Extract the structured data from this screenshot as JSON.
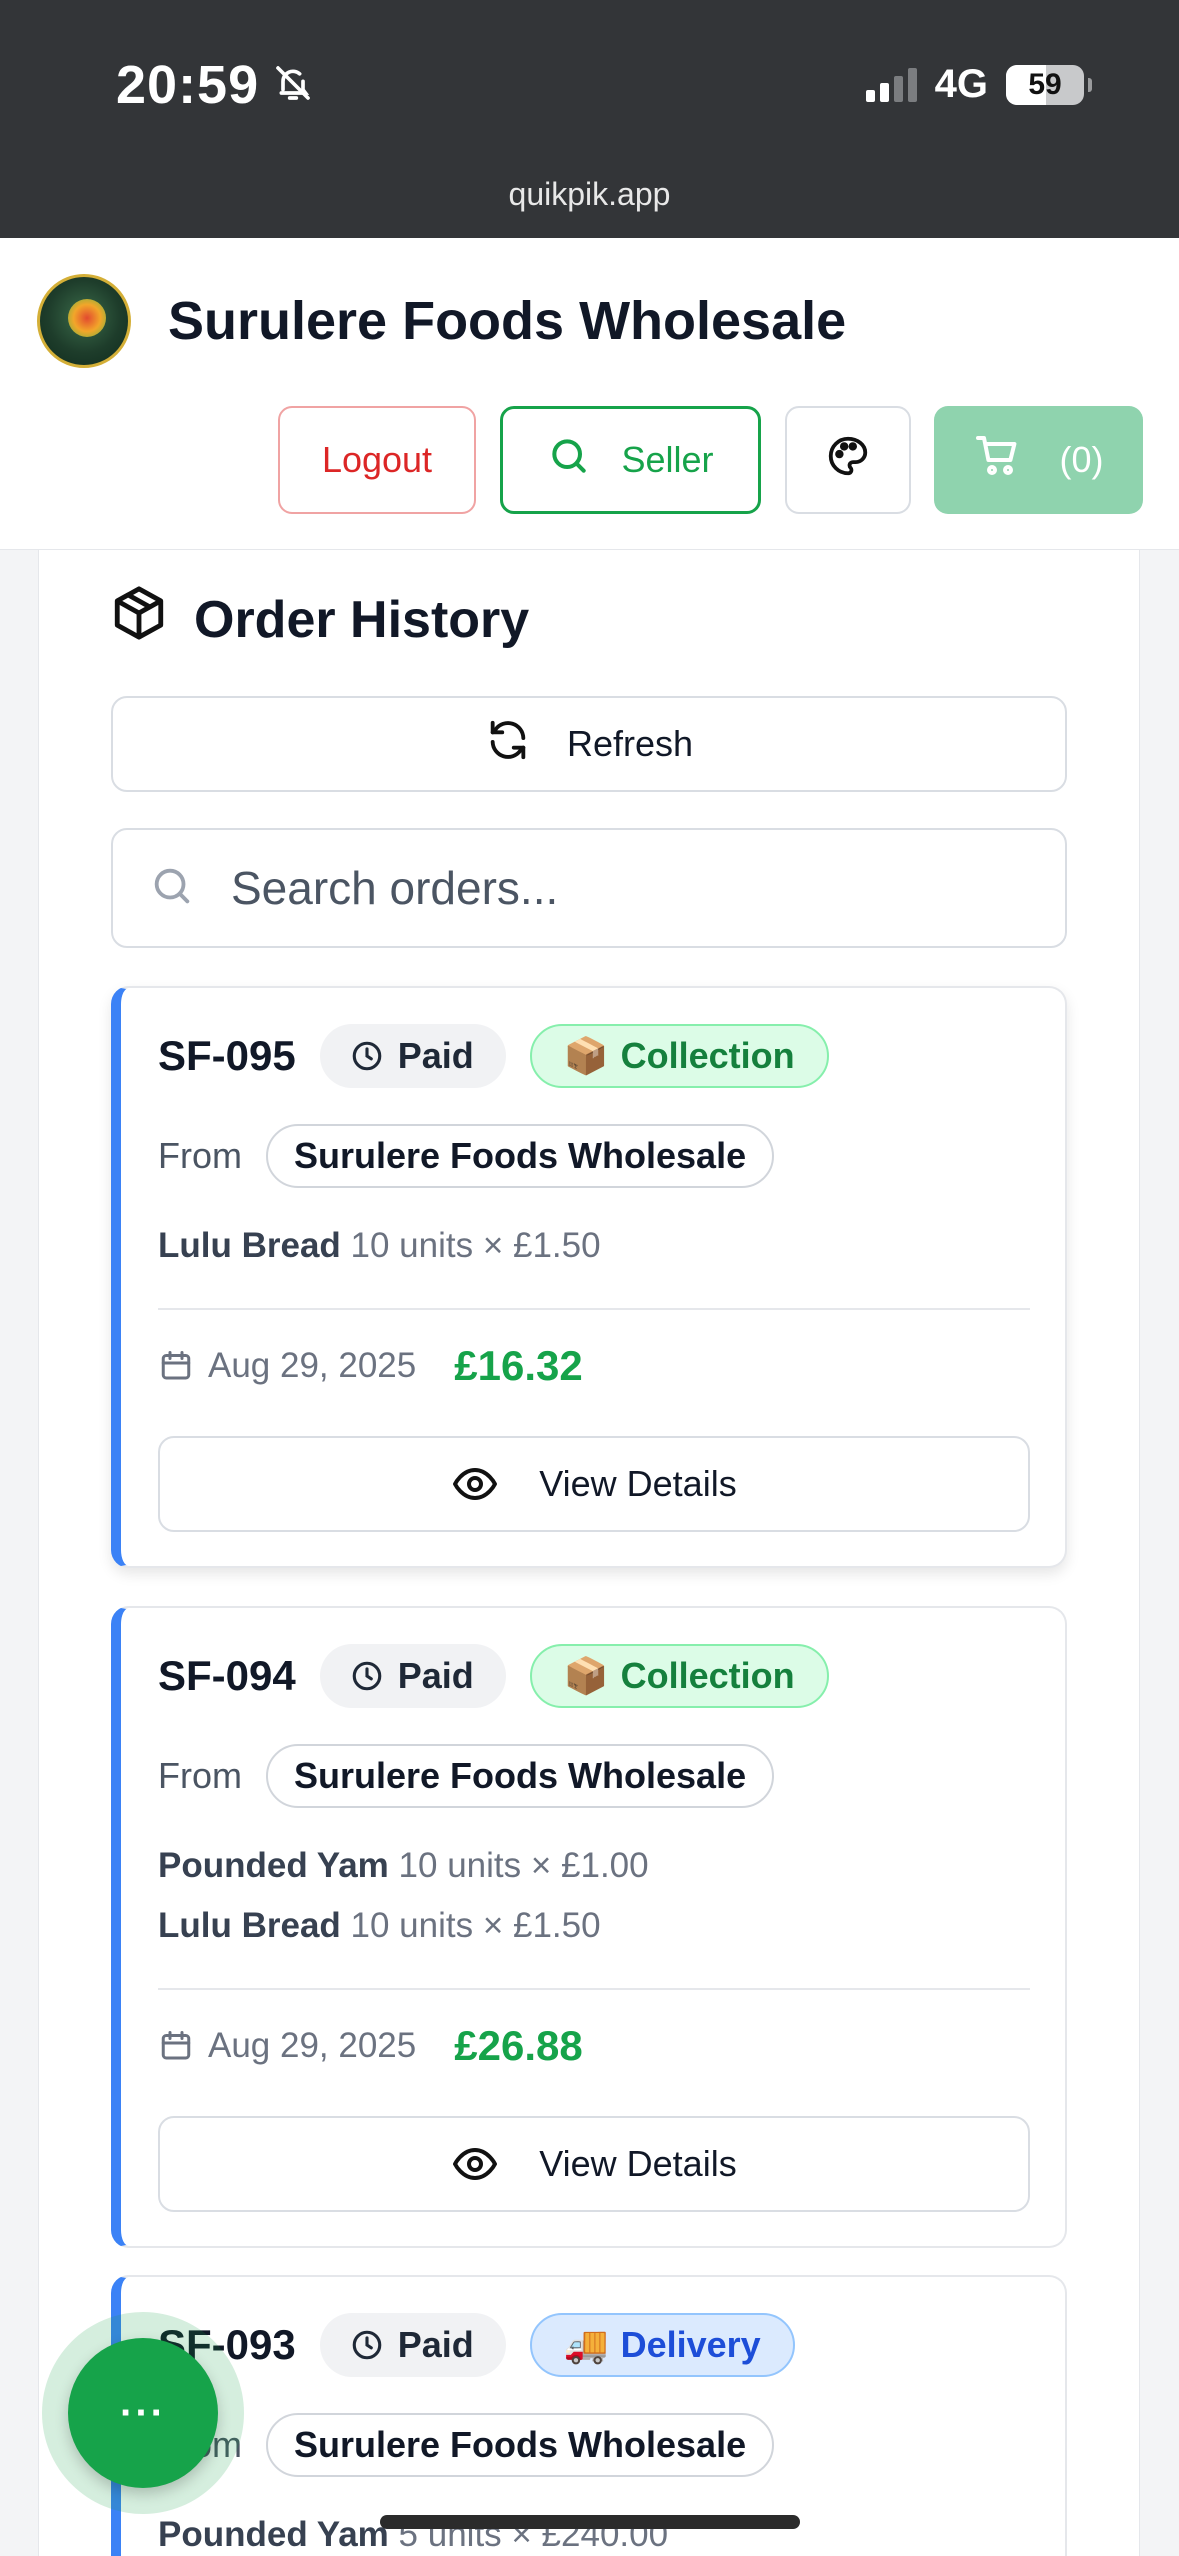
{
  "status_bar": {
    "time": "20:59",
    "network": "4G",
    "battery": "59",
    "url": "quikpik.app"
  },
  "header": {
    "brand": "Surulere Foods Wholesale",
    "logout_label": "Logout",
    "seller_label": "Seller",
    "cart_label": "(0)"
  },
  "orders_section": {
    "title": "Order History",
    "refresh_label": "Refresh",
    "search_placeholder": "Search orders..."
  },
  "orders": [
    {
      "id": "SF-095",
      "status": "Paid",
      "fulfilment_emoji": "📦",
      "fulfilment": "Collection",
      "from_label": "From",
      "seller": "Surulere Foods Wholesale",
      "items": [
        {
          "name": "Lulu Bread",
          "qty": "10 units × £1.50"
        }
      ],
      "date": "Aug 29, 2025",
      "total": "£16.32",
      "view_label": "View Details"
    },
    {
      "id": "SF-094",
      "status": "Paid",
      "fulfilment_emoji": "📦",
      "fulfilment": "Collection",
      "from_label": "From",
      "seller": "Surulere Foods Wholesale",
      "items": [
        {
          "name": "Pounded Yam",
          "qty": "10 units × £1.00"
        },
        {
          "name": "Lulu Bread",
          "qty": "10 units × £1.50"
        }
      ],
      "date": "Aug 29, 2025",
      "total": "£26.88",
      "view_label": "View Details"
    },
    {
      "id": "SF-093",
      "status": "Paid",
      "fulfilment_emoji": "🚚",
      "fulfilment": "Delivery",
      "from_label": "From",
      "seller": "Surulere Foods Wholesale",
      "items": [
        {
          "name": "Pounded Yam",
          "qty": "5 units × £240.00"
        }
      ]
    }
  ],
  "fab_label": "···",
  "colors": {
    "accent_green": "#16a34a",
    "accent_blue": "#3b82f6",
    "danger_red": "#dc2626"
  }
}
